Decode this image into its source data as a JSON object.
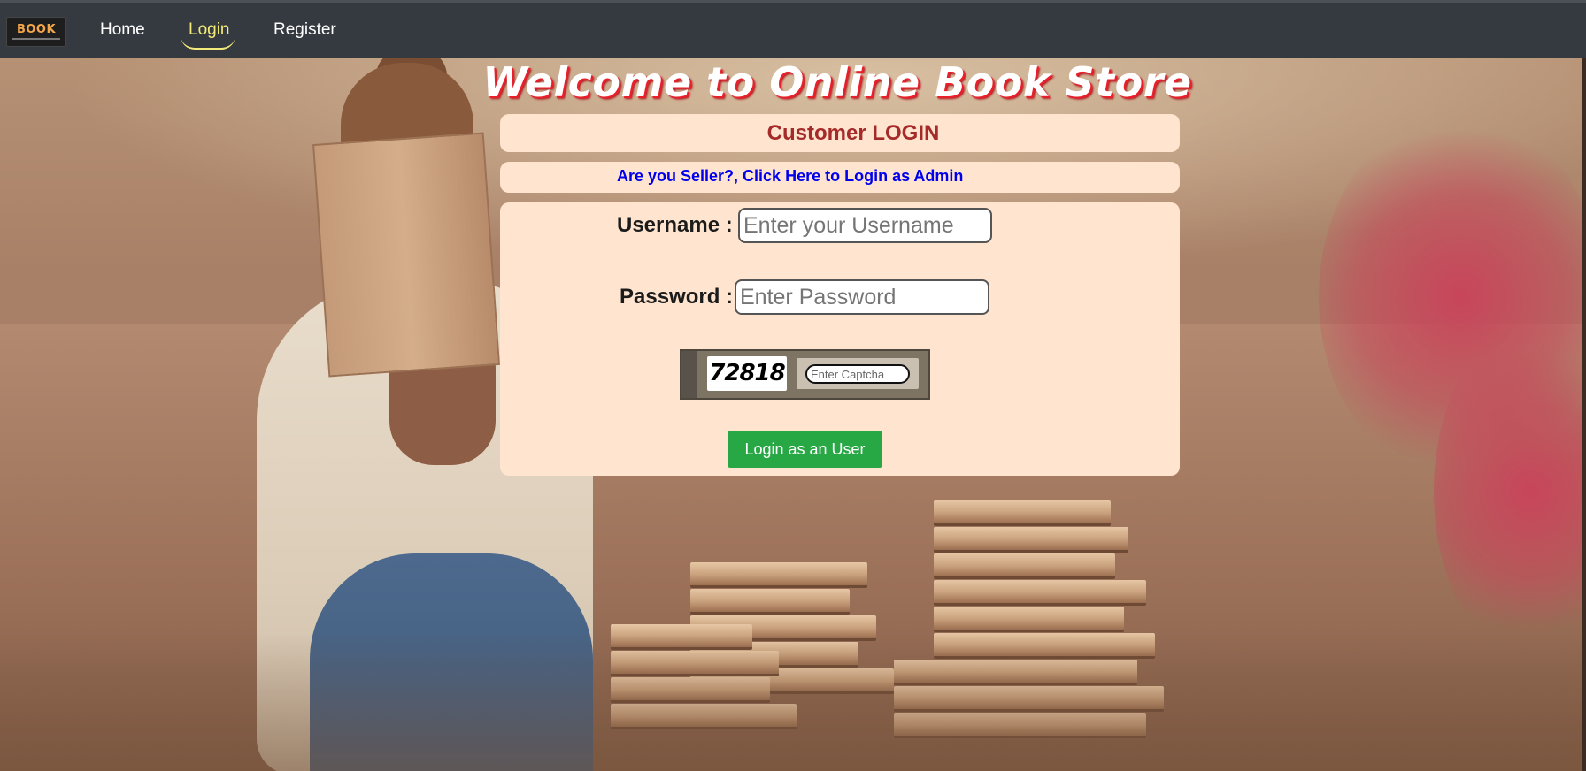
{
  "navbar": {
    "brand_text": "BOOK",
    "items": [
      {
        "label": "Home"
      },
      {
        "label": "Login"
      },
      {
        "label": "Register"
      }
    ]
  },
  "page": {
    "title": "Welcome to Online Book Store"
  },
  "login_panel": {
    "heading": "Customer LOGIN",
    "admin_link": "Are you Seller?, Click Here to Login as Admin",
    "username_label": "Username :",
    "username_placeholder": "Enter your Username",
    "password_label": "Password :",
    "password_placeholder": "Enter Password",
    "captcha_code": "72818",
    "captcha_placeholder": "Enter Captcha",
    "submit_label": "Login as an User"
  },
  "colors": {
    "navbar_bg": "#343a40",
    "active_nav": "#f3ea7a",
    "panel_bg": "#ffe5cf",
    "heading_color": "#a52a2a",
    "link_color": "#0000ee",
    "button_bg": "#28a745",
    "title_shadow": "#e8202a"
  }
}
